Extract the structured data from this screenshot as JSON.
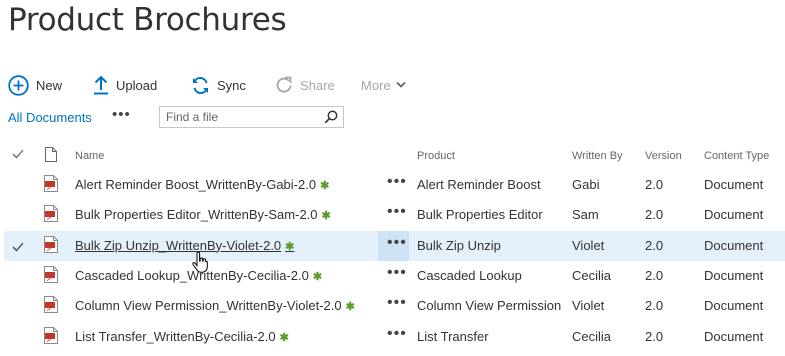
{
  "title": "Product Brochures",
  "toolbar": {
    "new_label": "New",
    "upload_label": "Upload",
    "sync_label": "Sync",
    "share_label": "Share",
    "more_label": "More"
  },
  "view": {
    "name": "All Documents",
    "ellipsis": "•••",
    "search_placeholder": "Find a file"
  },
  "columns": {
    "name": "Name",
    "product": "Product",
    "written_by": "Written By",
    "version": "Version",
    "content_type": "Content Type"
  },
  "rows": [
    {
      "name": "Alert Reminder Boost_WrittenBy-Gabi-2.0",
      "product": "Alert Reminder Boost",
      "writer": "Gabi",
      "version": "2.0",
      "ctype": "Document",
      "dots": "•••",
      "new_mark": "✱"
    },
    {
      "name": "Bulk Properties Editor_WrittenBy-Sam-2.0",
      "product": "Bulk Properties Editor",
      "writer": "Sam",
      "version": "2.0",
      "ctype": "Document",
      "dots": "•••",
      "new_mark": "✱"
    },
    {
      "name": "Bulk Zip Unzip_WrittenBy-Violet-2.0",
      "product": "Bulk Zip Unzip",
      "writer": "Violet",
      "version": "2.0",
      "ctype": "Document",
      "dots": "•••",
      "new_mark": "✱"
    },
    {
      "name": "Cascaded Lookup_WrittenBy-Cecilia-2.0",
      "product": "Cascaded Lookup",
      "writer": "Cecilia",
      "version": "2.0",
      "ctype": "Document",
      "dots": "•••",
      "new_mark": "✱"
    },
    {
      "name": "Column View Permission_WrittenBy-Violet-2.0",
      "product": "Column View Permission",
      "writer": "Violet",
      "version": "2.0",
      "ctype": "Document",
      "dots": "•••",
      "new_mark": "✱"
    },
    {
      "name": "List Transfer_WrittenBy-Cecilia-2.0",
      "product": "List Transfer",
      "writer": "Cecilia",
      "version": "2.0",
      "ctype": "Document",
      "dots": "•••",
      "new_mark": "✱"
    }
  ],
  "selected_row": 2,
  "icons": {
    "new": "plus-circle-icon",
    "upload": "upload-arrow-icon",
    "sync": "sync-icon",
    "share": "share-icon",
    "more": "chevron-down-icon",
    "search": "search-icon",
    "file": "pdf-file-icon",
    "check": "check-icon",
    "header_file": "document-icon"
  },
  "colors": {
    "accent": "#0072c6",
    "selected_row": "#e4f0fa",
    "new_mark": "#5b9b2e",
    "pdf_red": "#c0392b"
  }
}
